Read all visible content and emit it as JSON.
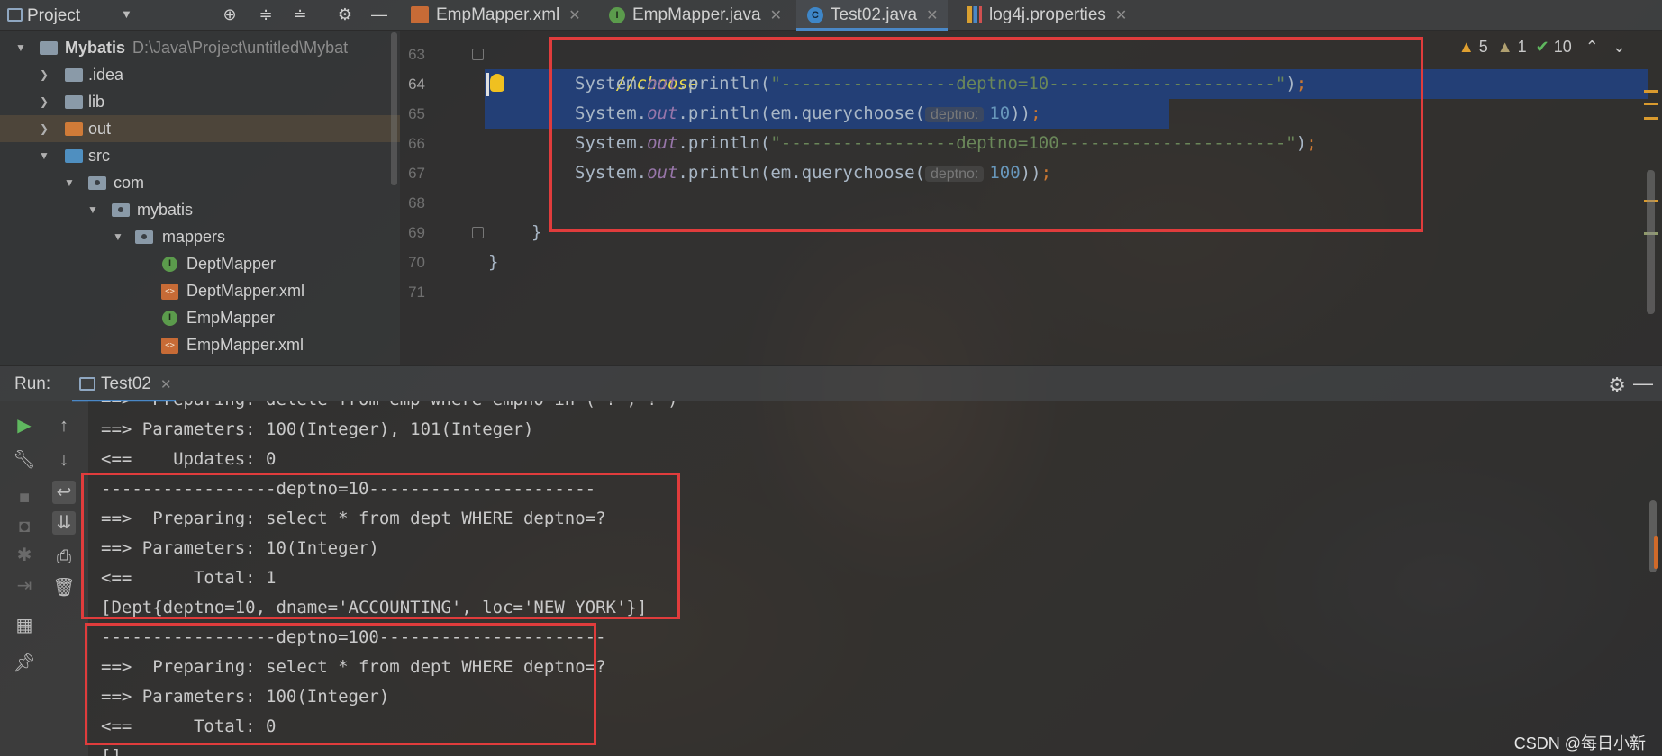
{
  "project_panel": {
    "title": "Project",
    "tree": [
      {
        "label": "Mybatis",
        "path": "D:\\Java\\Project\\untitled\\Mybat",
        "type": "project"
      },
      {
        "label": ".idea",
        "type": "folder"
      },
      {
        "label": "lib",
        "type": "folder"
      },
      {
        "label": "out",
        "type": "folder-excluded"
      },
      {
        "label": "src",
        "type": "source-folder"
      },
      {
        "label": "com",
        "type": "package"
      },
      {
        "label": "mybatis",
        "type": "package"
      },
      {
        "label": "mappers",
        "type": "package"
      },
      {
        "label": "DeptMapper",
        "type": "interface"
      },
      {
        "label": "DeptMapper.xml",
        "type": "xml"
      },
      {
        "label": "EmpMapper",
        "type": "interface"
      },
      {
        "label": "EmpMapper.xml",
        "type": "xml"
      }
    ]
  },
  "editor_tabs": [
    {
      "label": "EmpMapper.xml",
      "icon": "xml-file-icon",
      "active": false
    },
    {
      "label": "EmpMapper.java",
      "icon": "interface-icon",
      "active": false
    },
    {
      "label": "Test02.java",
      "icon": "class-icon",
      "active": true
    },
    {
      "label": "log4j.properties",
      "icon": "properties-icon",
      "active": false
    }
  ],
  "editor": {
    "line_numbers": [
      "63",
      "64",
      "65",
      "66",
      "67",
      "68",
      "69",
      "70",
      "71"
    ],
    "current_line": "64",
    "inspections": {
      "warnings": "5",
      "weak_warnings": "1",
      "ok": "10"
    },
    "code": {
      "l63_comment": "//choose",
      "l64_prefix": "System.",
      "l64_field": "out",
      "l64_method": ".println(",
      "l64_string": "\"-----------------deptno=10----------------------\"",
      "l64_end": ")",
      "semicolon": ";",
      "l65_prefix": "System.",
      "l65_field": "out",
      "l65_call": ".println(em.querychoose(",
      "l65_hint": "deptno:",
      "l65_arg": "10",
      "l65_end": "))",
      "l66_prefix": "System.",
      "l66_field": "out",
      "l66_method": ".println(",
      "l66_string": "\"-----------------deptno=100----------------------\"",
      "l66_end": ")",
      "l67_prefix": "System.",
      "l67_field": "out",
      "l67_call": ".println(em.querychoose(",
      "l67_hint": "deptno:",
      "l67_arg": "100",
      "l67_end": "))",
      "l69": "}",
      "l70": "}"
    }
  },
  "run_panel": {
    "label": "Run:",
    "tab": "Test02",
    "console": [
      "==>  Preparing: delete from emp where empno in ( ? , ? )",
      "==> Parameters: 100(Integer), 101(Integer)",
      "<==    Updates: 0",
      "-----------------deptno=10----------------------",
      "==>  Preparing: select * from dept WHERE deptno=?",
      "==> Parameters: 10(Integer)",
      "<==      Total: 1",
      "[Dept{deptno=10, dname='ACCOUNTING', loc='NEW YORK'}]",
      "-----------------deptno=100----------------------",
      "==>  Preparing: select * from dept WHERE deptno=?",
      "==> Parameters: 100(Integer)",
      "<==      Total: 0",
      "[]"
    ]
  },
  "watermark": "CSDN @每日小新",
  "colors": {
    "accent": "#4a88c7",
    "annotation_box": "#e03c3c",
    "selection": "#214283"
  }
}
